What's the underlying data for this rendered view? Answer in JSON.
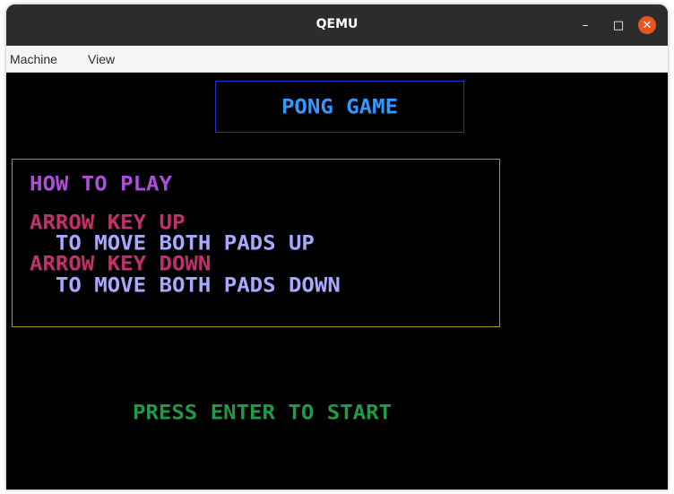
{
  "window": {
    "title": "QEMU",
    "controls": {
      "minimize": "–",
      "maximize": "□",
      "close": "✕"
    }
  },
  "menubar": {
    "items": [
      "Machine",
      "View"
    ]
  },
  "game": {
    "title": "PONG GAME",
    "how_to_play": {
      "heading": "HOW TO PLAY",
      "lines": [
        "ARROW KEY UP",
        "  TO MOVE BOTH PADS UP",
        "ARROW KEY DOWN",
        "  TO MOVE BOTH PADS DOWN"
      ]
    },
    "prompt": "PRESS ENTER TO START"
  },
  "colors": {
    "title_border": "#1a33cc",
    "title_text": "#3399ff",
    "howto_border": "#a09a1e",
    "heading": "#b04ce0",
    "key_text": "#c4306c",
    "description_text": "#a8a8ff",
    "prompt_text": "#1f9a48",
    "close_button": "#e95420"
  }
}
